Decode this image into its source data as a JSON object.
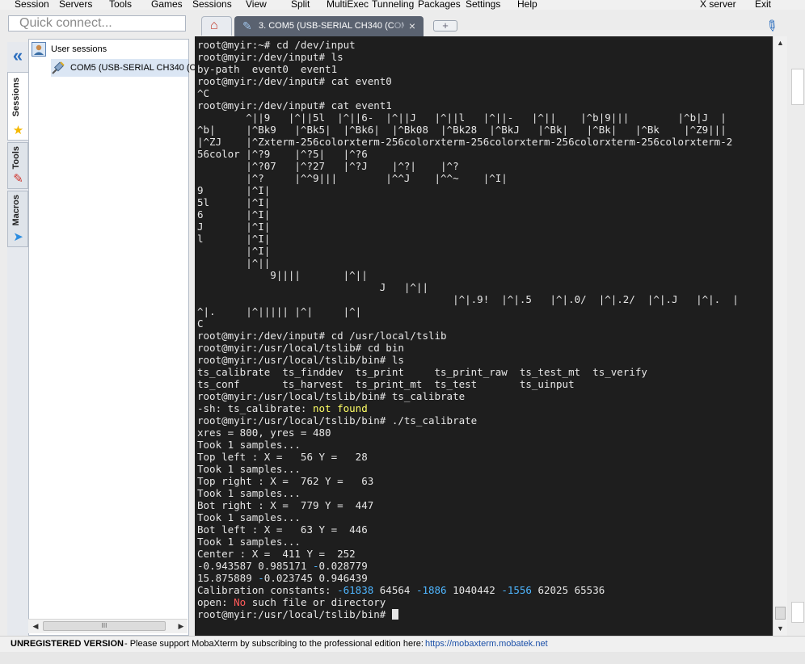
{
  "menu": [
    "Session",
    "Servers",
    "Tools",
    "Games",
    "Sessions",
    "View",
    "Split",
    "MultiExec",
    "Tunneling",
    "Packages",
    "Settings",
    "Help",
    "X server",
    "Exit"
  ],
  "quick_connect": {
    "placeholder": "Quick connect..."
  },
  "side_tabs": {
    "sessions": "Sessions",
    "tools": "Tools",
    "macros": "Macros"
  },
  "sessions_tree": {
    "root": "User sessions",
    "item": "COM5  (USB-SERIAL CH340 (C"
  },
  "scroll_thumb_glyph": "III",
  "tabs": {
    "session_tab_title": "3. COM5  (USB-SERIAL CH340 (C",
    "session_tab_fade": "OM",
    "close": "×",
    "add": "+"
  },
  "icons": {
    "home": "home-icon",
    "session": "serial-plug-icon",
    "attach": "paperclip-icon",
    "star": "star-icon",
    "tools": "tools-icon",
    "macros": "paper-plane-icon"
  },
  "terminal": {
    "prompt_final": "root@myir:/usr/local/tslib/bin# ",
    "segments": [
      {
        "t": "root@myir:~# cd /dev/input\nroot@myir:/dev/input# ls\nby-path  event0  event1\nroot@myir:/dev/input# cat event0\n^C\nroot@myir:/dev/input# cat event1\n        ^||9   |^||5l  |^||6-  |^||J   |^||l   |^||-   |^||    |^b|9|||        |^b|J  |\n^b|     |^Bk9   |^Bk5|  |^Bk6|  |^Bk08  |^Bk28  |^BkJ   |^Bk|   |^Bk|   |^Bk    |^Z9|||\n|^ZJ    |^Zxterm-256colorxterm-256colorxterm-256colorxterm-256colorxterm-256colorxterm-2\n56color |^?9    |^?5|   |^?6\n        |^?07   |^?27   |^?J    |^?|    |^?\n        |^?     |^^9|||        |^^J    |^^~    |^I|\n9       |^I|\n5l      |^I|\n6       |^I|\nJ       |^I|\nl       |^I|\n        |^I|\n        |^||\n            9||||       |^||\n                              J   |^||\n                                          |^|.9!  |^|.5   |^|.0/  |^|.2/  |^|.J   |^|.  |\n^|.     |^||||| |^|     |^|\nC\nroot@myir:/dev/input# cd /usr/local/tslib\nroot@myir:/usr/local/tslib# cd bin\nroot@myir:/usr/local/tslib/bin# ls\nts_calibrate  ts_finddev  ts_print     ts_print_raw  ts_test_mt  ts_verify\nts_conf       ts_harvest  ts_print_mt  ts_test       ts_uinput\nroot@myir:/usr/local/tslib/bin# ts_calibrate\n-sh: ts_calibrate: ",
        "c": ""
      },
      {
        "t": "not found",
        "c": "t-yellow"
      },
      {
        "t": "\nroot@myir:/usr/local/tslib/bin# ./ts_calibrate\nxres = 800, yres = 480\nTook 1 samples...\nTop left : X =   56 Y =   28\nTook 1 samples...\nTop right : X =  762 Y =   63\nTook 1 samples...\nBot right : X =  779 Y =  447\nTook 1 samples...\nBot left : X =   63 Y =  446\nTook 1 samples...\nCenter : X =  411 Y =  252\n",
        "c": ""
      },
      {
        "t": "-0.943587",
        "c": ""
      },
      {
        "t": " 0.985171 ",
        "c": ""
      },
      {
        "t": "-",
        "c": "t-cyan"
      },
      {
        "t": "0.028779\n15.875889 ",
        "c": ""
      },
      {
        "t": "-",
        "c": "t-cyan"
      },
      {
        "t": "0.023745 0.946439\nCalibration constants: ",
        "c": ""
      },
      {
        "t": "-61838",
        "c": "t-cyan"
      },
      {
        "t": " 64564 ",
        "c": ""
      },
      {
        "t": "-1886",
        "c": "t-cyan"
      },
      {
        "t": " 1040442 ",
        "c": ""
      },
      {
        "t": "-1556",
        "c": "t-cyan"
      },
      {
        "t": " 62025 65536\nopen: ",
        "c": ""
      },
      {
        "t": "No",
        "c": "t-red"
      },
      {
        "t": " such file or directory\n",
        "c": ""
      }
    ]
  },
  "status": {
    "unregistered": "UNREGISTERED VERSION",
    "message": "-  Please support MobaXterm by subscribing to the professional edition here:",
    "link": "https://mobaxterm.mobatek.net"
  },
  "colors": {
    "terminal_bg": "#1e1e1e",
    "tab_active": "#5a6270",
    "accent": "#2d6fbf"
  }
}
